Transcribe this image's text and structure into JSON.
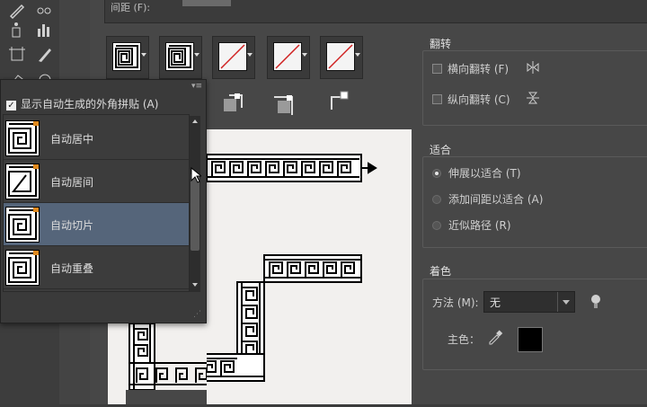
{
  "top_field": {
    "label": "间距 (F):",
    "value": ""
  },
  "tiles": {
    "count_visible": 5
  },
  "popup": {
    "show_auto_corners_label": "显示自动生成的外角拼贴 (A)",
    "show_auto_corners_checked": true,
    "items": [
      {
        "label": "自动居中",
        "selected": false
      },
      {
        "label": "自动居间",
        "selected": false
      },
      {
        "label": "自动切片",
        "selected": true
      },
      {
        "label": "自动重叠",
        "selected": false
      }
    ]
  },
  "flip": {
    "title": "翻转",
    "horizontal_label": "横向翻转 (F)",
    "vertical_label": "纵向翻转 (C)"
  },
  "fit": {
    "title": "适合",
    "options": [
      {
        "label": "伸展以适合 (T)",
        "selected": true
      },
      {
        "label": "添加间距以适合 (A)",
        "selected": false
      },
      {
        "label": "近似路径 (R)",
        "selected": false
      }
    ]
  },
  "colors": {
    "title": "着色",
    "method_label": "方法 (M):",
    "method_value": "无",
    "key_color_label": "主色：",
    "key_color": "#000000"
  },
  "ui_colors": {
    "selected_row": "#55657a",
    "dialog_bg": "#474747"
  }
}
